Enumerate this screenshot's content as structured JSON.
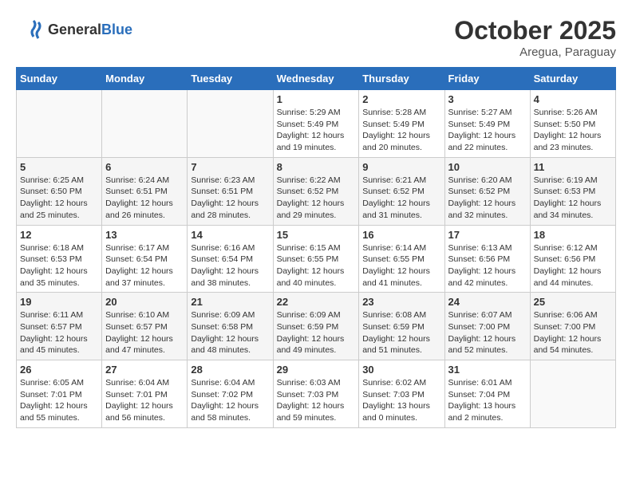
{
  "logo": {
    "general": "General",
    "blue": "Blue"
  },
  "header": {
    "month": "October 2025",
    "location": "Aregua, Paraguay"
  },
  "weekdays": [
    "Sunday",
    "Monday",
    "Tuesday",
    "Wednesday",
    "Thursday",
    "Friday",
    "Saturday"
  ],
  "weeks": [
    [
      {
        "day": "",
        "info": ""
      },
      {
        "day": "",
        "info": ""
      },
      {
        "day": "",
        "info": ""
      },
      {
        "day": "1",
        "info": "Sunrise: 5:29 AM\nSunset: 5:49 PM\nDaylight: 12 hours\nand 19 minutes."
      },
      {
        "day": "2",
        "info": "Sunrise: 5:28 AM\nSunset: 5:49 PM\nDaylight: 12 hours\nand 20 minutes."
      },
      {
        "day": "3",
        "info": "Sunrise: 5:27 AM\nSunset: 5:49 PM\nDaylight: 12 hours\nand 22 minutes."
      },
      {
        "day": "4",
        "info": "Sunrise: 5:26 AM\nSunset: 5:50 PM\nDaylight: 12 hours\nand 23 minutes."
      }
    ],
    [
      {
        "day": "5",
        "info": "Sunrise: 6:25 AM\nSunset: 6:50 PM\nDaylight: 12 hours\nand 25 minutes."
      },
      {
        "day": "6",
        "info": "Sunrise: 6:24 AM\nSunset: 6:51 PM\nDaylight: 12 hours\nand 26 minutes."
      },
      {
        "day": "7",
        "info": "Sunrise: 6:23 AM\nSunset: 6:51 PM\nDaylight: 12 hours\nand 28 minutes."
      },
      {
        "day": "8",
        "info": "Sunrise: 6:22 AM\nSunset: 6:52 PM\nDaylight: 12 hours\nand 29 minutes."
      },
      {
        "day": "9",
        "info": "Sunrise: 6:21 AM\nSunset: 6:52 PM\nDaylight: 12 hours\nand 31 minutes."
      },
      {
        "day": "10",
        "info": "Sunrise: 6:20 AM\nSunset: 6:52 PM\nDaylight: 12 hours\nand 32 minutes."
      },
      {
        "day": "11",
        "info": "Sunrise: 6:19 AM\nSunset: 6:53 PM\nDaylight: 12 hours\nand 34 minutes."
      }
    ],
    [
      {
        "day": "12",
        "info": "Sunrise: 6:18 AM\nSunset: 6:53 PM\nDaylight: 12 hours\nand 35 minutes."
      },
      {
        "day": "13",
        "info": "Sunrise: 6:17 AM\nSunset: 6:54 PM\nDaylight: 12 hours\nand 37 minutes."
      },
      {
        "day": "14",
        "info": "Sunrise: 6:16 AM\nSunset: 6:54 PM\nDaylight: 12 hours\nand 38 minutes."
      },
      {
        "day": "15",
        "info": "Sunrise: 6:15 AM\nSunset: 6:55 PM\nDaylight: 12 hours\nand 40 minutes."
      },
      {
        "day": "16",
        "info": "Sunrise: 6:14 AM\nSunset: 6:55 PM\nDaylight: 12 hours\nand 41 minutes."
      },
      {
        "day": "17",
        "info": "Sunrise: 6:13 AM\nSunset: 6:56 PM\nDaylight: 12 hours\nand 42 minutes."
      },
      {
        "day": "18",
        "info": "Sunrise: 6:12 AM\nSunset: 6:56 PM\nDaylight: 12 hours\nand 44 minutes."
      }
    ],
    [
      {
        "day": "19",
        "info": "Sunrise: 6:11 AM\nSunset: 6:57 PM\nDaylight: 12 hours\nand 45 minutes."
      },
      {
        "day": "20",
        "info": "Sunrise: 6:10 AM\nSunset: 6:57 PM\nDaylight: 12 hours\nand 47 minutes."
      },
      {
        "day": "21",
        "info": "Sunrise: 6:09 AM\nSunset: 6:58 PM\nDaylight: 12 hours\nand 48 minutes."
      },
      {
        "day": "22",
        "info": "Sunrise: 6:09 AM\nSunset: 6:59 PM\nDaylight: 12 hours\nand 49 minutes."
      },
      {
        "day": "23",
        "info": "Sunrise: 6:08 AM\nSunset: 6:59 PM\nDaylight: 12 hours\nand 51 minutes."
      },
      {
        "day": "24",
        "info": "Sunrise: 6:07 AM\nSunset: 7:00 PM\nDaylight: 12 hours\nand 52 minutes."
      },
      {
        "day": "25",
        "info": "Sunrise: 6:06 AM\nSunset: 7:00 PM\nDaylight: 12 hours\nand 54 minutes."
      }
    ],
    [
      {
        "day": "26",
        "info": "Sunrise: 6:05 AM\nSunset: 7:01 PM\nDaylight: 12 hours\nand 55 minutes."
      },
      {
        "day": "27",
        "info": "Sunrise: 6:04 AM\nSunset: 7:01 PM\nDaylight: 12 hours\nand 56 minutes."
      },
      {
        "day": "28",
        "info": "Sunrise: 6:04 AM\nSunset: 7:02 PM\nDaylight: 12 hours\nand 58 minutes."
      },
      {
        "day": "29",
        "info": "Sunrise: 6:03 AM\nSunset: 7:03 PM\nDaylight: 12 hours\nand 59 minutes."
      },
      {
        "day": "30",
        "info": "Sunrise: 6:02 AM\nSunset: 7:03 PM\nDaylight: 13 hours\nand 0 minutes."
      },
      {
        "day": "31",
        "info": "Sunrise: 6:01 AM\nSunset: 7:04 PM\nDaylight: 13 hours\nand 2 minutes."
      },
      {
        "day": "",
        "info": ""
      }
    ]
  ]
}
